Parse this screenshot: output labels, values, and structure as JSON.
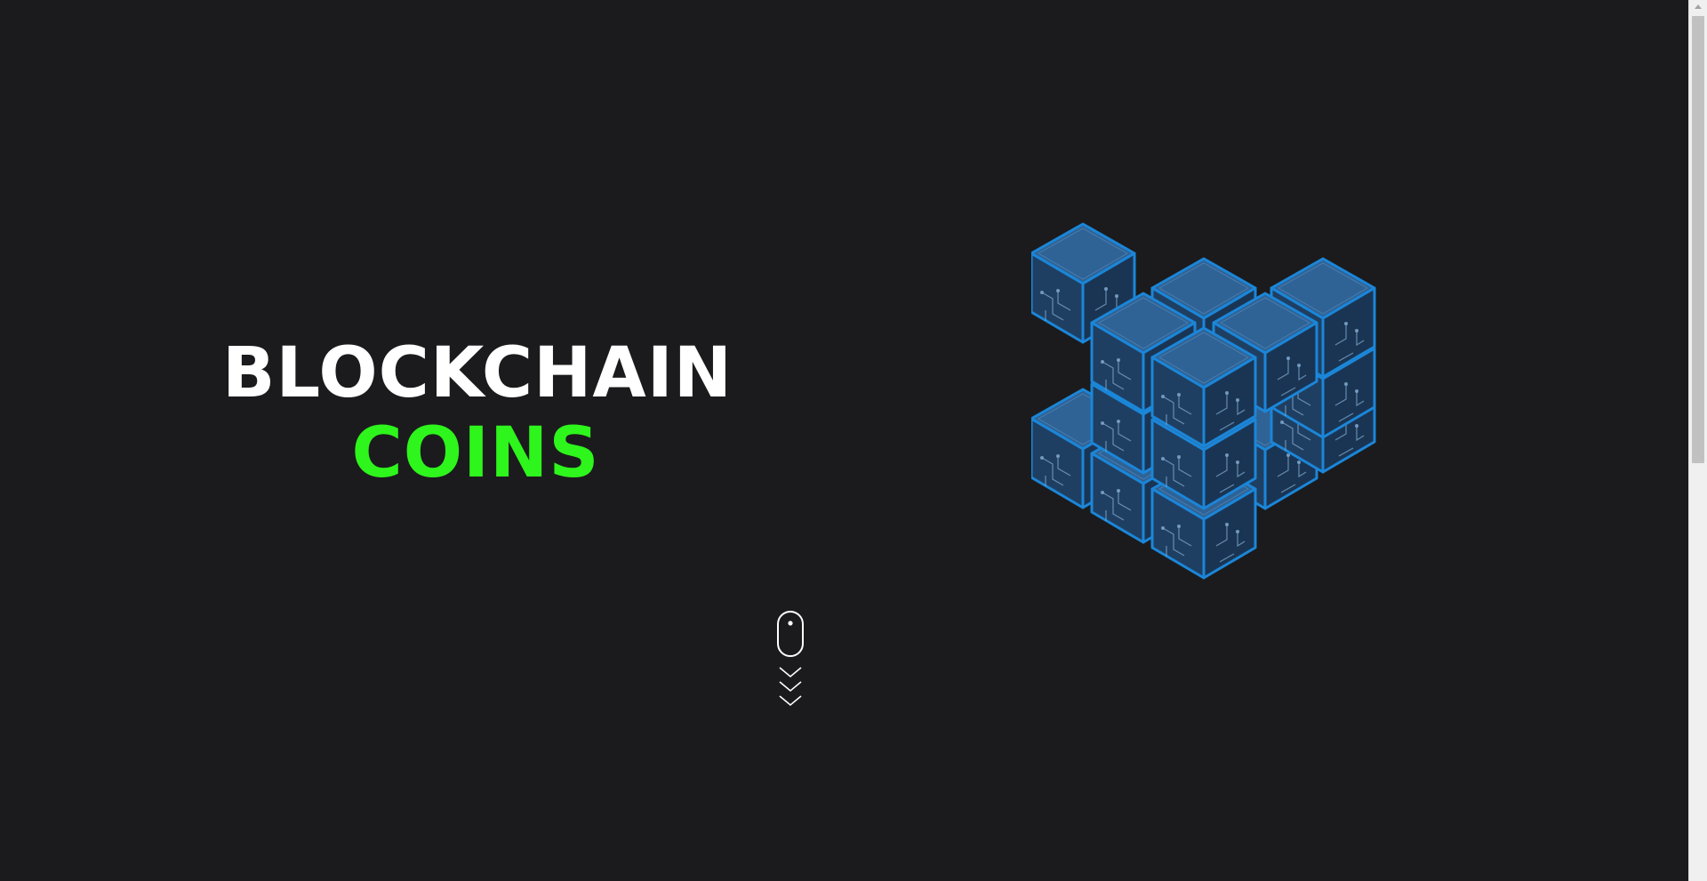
{
  "hero": {
    "line1": "BLOCKCHAIN",
    "line2": "COINS"
  },
  "colors": {
    "background": "#1b1b1d",
    "line1": "#ffffff",
    "line2_accent": "#2ef51c",
    "cube_face": "#255380",
    "cube_edge": "#1b86d8"
  },
  "illustration": {
    "icon": "blockchain-cubes-icon"
  },
  "scroll_hint": {
    "icon": "mouse-scroll-icon"
  }
}
